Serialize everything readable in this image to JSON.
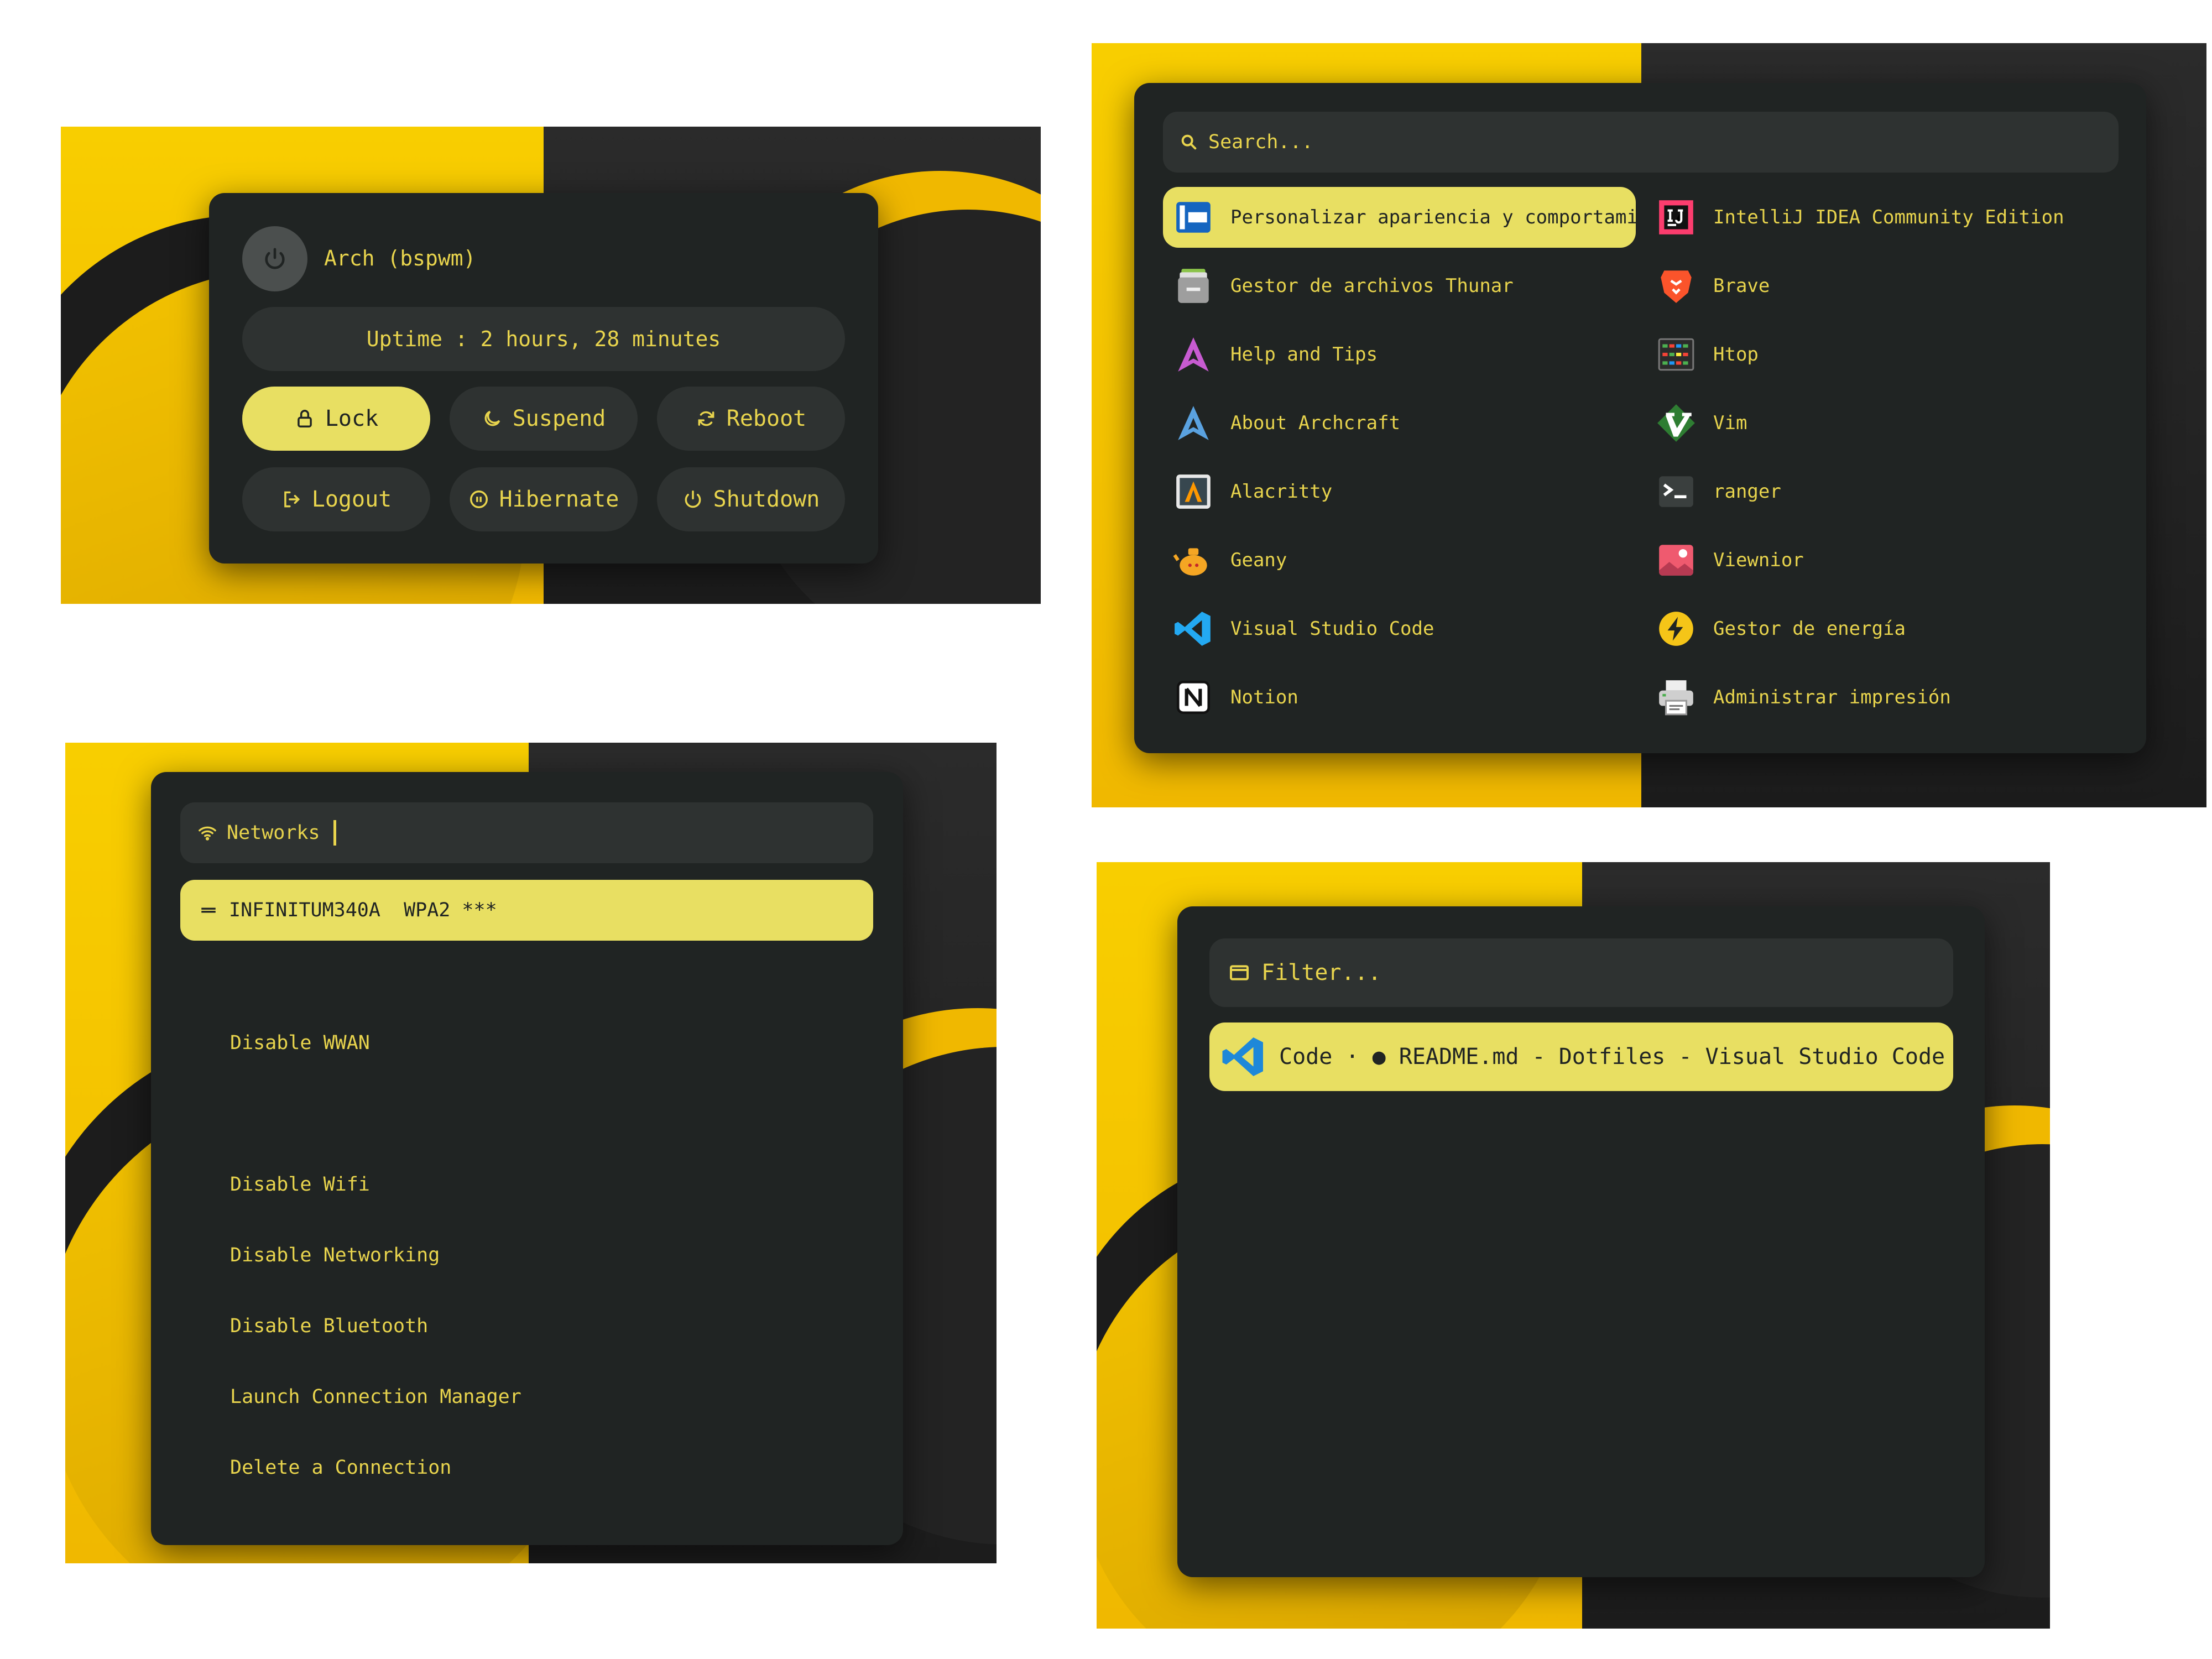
{
  "power_menu": {
    "host": "Arch (bspwm)",
    "uptime": "Uptime : 2 hours, 28 minutes",
    "icons": {
      "avatar": "power-icon"
    },
    "buttons": [
      {
        "label": "Lock",
        "icon": "lock-icon",
        "active": true
      },
      {
        "label": "Suspend",
        "icon": "moon-icon"
      },
      {
        "label": "Reboot",
        "icon": "refresh-icon"
      },
      {
        "label": "Logout",
        "icon": "logout-icon"
      },
      {
        "label": "Hibernate",
        "icon": "pause-circle-icon"
      },
      {
        "label": "Shutdown",
        "icon": "power-icon"
      }
    ]
  },
  "app_launcher": {
    "search_placeholder": "Search...",
    "items": [
      {
        "label": "Personalizar apariencia y comportamie...",
        "icon": "appearance-settings-icon",
        "active": true
      },
      {
        "label": "IntelliJ IDEA Community Edition",
        "icon": "intellij-icon"
      },
      {
        "label": "Gestor de archivos Thunar",
        "icon": "file-cabinet-icon"
      },
      {
        "label": "Brave",
        "icon": "brave-lion-icon"
      },
      {
        "label": "Help and Tips",
        "icon": "arch-logo-icon"
      },
      {
        "label": "Htop",
        "icon": "htop-meter-icon"
      },
      {
        "label": "About Archcraft",
        "icon": "archcraft-logo-icon"
      },
      {
        "label": "Vim",
        "icon": "vim-icon"
      },
      {
        "label": "Alacritty",
        "icon": "alacritty-icon"
      },
      {
        "label": "ranger",
        "icon": "terminal-icon"
      },
      {
        "label": "Geany",
        "icon": "geany-teapot-icon"
      },
      {
        "label": "Viewnior",
        "icon": "image-viewer-icon"
      },
      {
        "label": "Visual Studio Code",
        "icon": "vscode-icon"
      },
      {
        "label": "Gestor de energía",
        "icon": "lightning-icon"
      },
      {
        "label": "Notion",
        "icon": "notion-icon"
      },
      {
        "label": "Administrar impresión",
        "icon": "printer-icon"
      }
    ]
  },
  "network_menu": {
    "prompt": "Networks",
    "icons": {
      "prompt": "wifi-icon",
      "active": "ethernet-icon"
    },
    "active_item": "INFINITUM340A  WPA2 ***",
    "items": [
      "Disable WWAN",
      "Disable Wifi",
      "Disable Networking",
      "Disable Bluetooth",
      "Launch Connection Manager",
      "Delete a Connection"
    ]
  },
  "window_switcher": {
    "filter_placeholder": "Filter...",
    "icons": {
      "filter": "window-icon",
      "active": "vscode-icon"
    },
    "active_item": "Code · ● README.md - Dotfiles - Visual Studio Code"
  },
  "colors": {
    "accent": "#e8df62",
    "text": "#e8d44d",
    "surface": "#202423",
    "field": "#2e3231",
    "wallpaper_yellow": "#f8ce00",
    "wallpaper_dark": "#262626"
  }
}
